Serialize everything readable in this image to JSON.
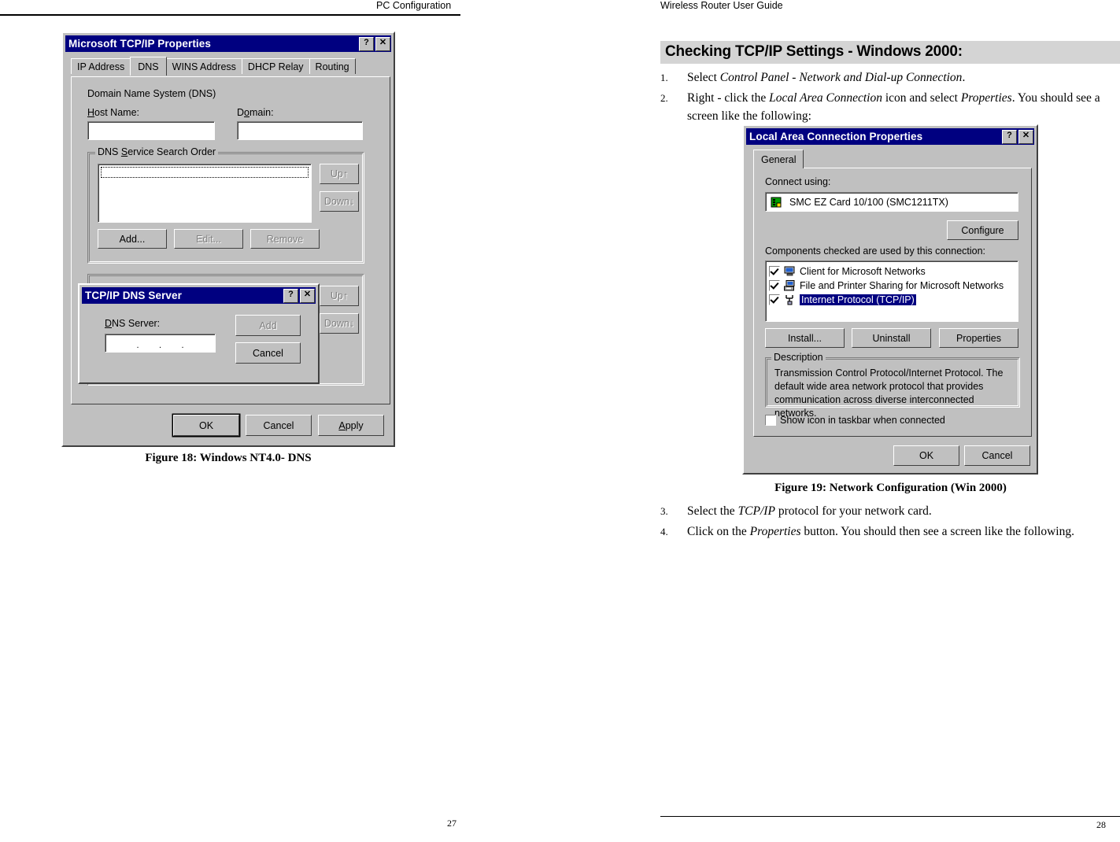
{
  "pages": {
    "left": {
      "running_head": "PC Configuration",
      "page_number": "27",
      "figure_caption": "Figure 18: Windows NT4.0- DNS"
    },
    "right": {
      "running_head": "Wireless Router User Guide",
      "page_number": "28",
      "heading": "Checking TCP/IP Settings - Windows 2000:",
      "figure_caption": "Figure 19: Network Configuration (Win 2000)",
      "steps_top": [
        {
          "num": "1.",
          "parts": [
            {
              "t": "Select ",
              "i": false
            },
            {
              "t": "Control Panel - Network and Dial-up Connection",
              "i": true
            },
            {
              "t": ".",
              "i": false
            }
          ]
        },
        {
          "num": "2.",
          "parts": [
            {
              "t": "Right - click the ",
              "i": false
            },
            {
              "t": "Local Area Connection",
              "i": true
            },
            {
              "t": " icon and select ",
              "i": false
            },
            {
              "t": "Properties",
              "i": true
            },
            {
              "t": ". You should see a screen like the following:",
              "i": false
            }
          ]
        }
      ],
      "steps_bottom": [
        {
          "num": "3.",
          "parts": [
            {
              "t": "Select the ",
              "i": false
            },
            {
              "t": "TCP/IP",
              "i": true
            },
            {
              "t": " protocol for your network card.",
              "i": false
            }
          ]
        },
        {
          "num": "4.",
          "parts": [
            {
              "t": "Click on the ",
              "i": false
            },
            {
              "t": "Properties",
              "i": true
            },
            {
              "t": " button. You should then see a screen like the following.",
              "i": false
            }
          ]
        }
      ]
    }
  },
  "dialog_nt": {
    "title": "Microsoft TCP/IP Properties",
    "titlebar_buttons": [
      "?",
      "✕"
    ],
    "tabs": [
      {
        "label": "IP Address",
        "selected": false
      },
      {
        "label": "DNS",
        "selected": true
      },
      {
        "label": "WINS Address",
        "selected": false
      },
      {
        "label": "DHCP Relay",
        "selected": false
      },
      {
        "label": "Routing",
        "selected": false
      }
    ],
    "section_label": "Domain Name System (DNS)",
    "host_name_label": "Host Name:",
    "host_name_value": "",
    "domain_label": "Domain:",
    "domain_value": "",
    "group_search_order": {
      "title": "DNS Service Search Order",
      "list_items": [],
      "up_label": "Up↑",
      "down_label": "Down↓",
      "add_label": "Add...",
      "edit_label": "Edit...",
      "remove_label": "Remove"
    },
    "group_secondary": {
      "up_label": "Up↑",
      "down_label": "Down↓"
    },
    "ok_label": "OK",
    "cancel_label": "Cancel",
    "apply_label": "Apply"
  },
  "dialog_dns_server": {
    "title": "TCP/IP DNS Server",
    "titlebar_buttons": [
      "?",
      "✕"
    ],
    "field_label": "DNS Server:",
    "field_value": "",
    "add_label": "Add",
    "cancel_label": "Cancel"
  },
  "dialog_lac": {
    "title": "Local Area Connection Properties",
    "titlebar_buttons": [
      "?",
      "✕"
    ],
    "tabs": [
      {
        "label": "General",
        "selected": true
      }
    ],
    "connect_using_label": "Connect using:",
    "adapter_name": "SMC EZ Card 10/100 (SMC1211TX)",
    "configure_label": "Configure",
    "components_label": "Components checked are used by this connection:",
    "components": [
      {
        "label": "Client for Microsoft Networks",
        "checked": true,
        "selected": false,
        "icon": "computer-icon"
      },
      {
        "label": "File and Printer Sharing for Microsoft Networks",
        "checked": true,
        "selected": false,
        "icon": "printer-sharing-icon"
      },
      {
        "label": "Internet Protocol (TCP/IP)",
        "checked": true,
        "selected": true,
        "icon": "protocol-icon"
      }
    ],
    "install_label": "Install...",
    "uninstall_label": "Uninstall",
    "properties_label": "Properties",
    "description_title": "Description",
    "description_text": "Transmission Control Protocol/Internet Protocol. The default wide area network protocol that provides communication across diverse interconnected networks.",
    "show_icon_label": "Show icon in taskbar when connected",
    "show_icon_checked": false,
    "ok_label": "OK",
    "cancel_label": "Cancel"
  },
  "colors": {
    "titlebar": "#000080",
    "face": "#c0c0c0",
    "heading_band": "#d4d4d4",
    "selection": "#000080"
  }
}
